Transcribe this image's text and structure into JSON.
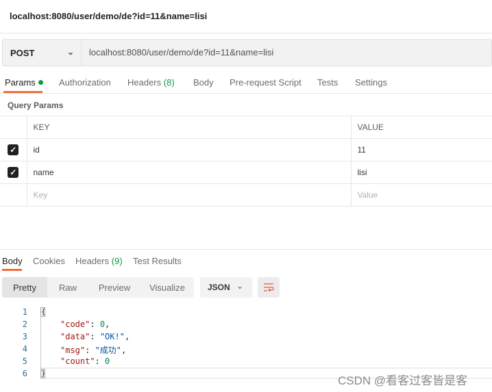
{
  "request_title": "localhost:8080/user/demo/de?id=11&name=lisi",
  "request": {
    "method": "POST",
    "url": "localhost:8080/user/demo/de?id=11&name=lisi"
  },
  "tabs": [
    {
      "label": "Params"
    },
    {
      "label": "Authorization"
    },
    {
      "label": "Headers",
      "count": "(8)"
    },
    {
      "label": "Body"
    },
    {
      "label": "Pre-request Script"
    },
    {
      "label": "Tests"
    },
    {
      "label": "Settings"
    }
  ],
  "query_params": {
    "title": "Query Params",
    "headers": {
      "key": "KEY",
      "value": "VALUE"
    },
    "rows": [
      {
        "key": "id",
        "value": "11",
        "checked": true
      },
      {
        "key": "name",
        "value": "lisi",
        "checked": true
      }
    ],
    "placeholder": {
      "key": "Key",
      "value": "Value"
    }
  },
  "response_tabs": [
    {
      "label": "Body"
    },
    {
      "label": "Cookies"
    },
    {
      "label": "Headers",
      "count": "(9)"
    },
    {
      "label": "Test Results"
    }
  ],
  "view_modes": [
    "Pretty",
    "Raw",
    "Preview",
    "Visualize"
  ],
  "format": "JSON",
  "code": {
    "line_numbers": [
      "1",
      "2",
      "3",
      "4",
      "5",
      "6"
    ],
    "open": "{",
    "close": "}",
    "fields": [
      {
        "key": "\"code\"",
        "value": "0",
        "sep": ",",
        "type": "n"
      },
      {
        "key": "\"data\"",
        "value": "\"OK!\"",
        "sep": ",",
        "type": "s"
      },
      {
        "key": "\"msg\"",
        "value": "\"成功\"",
        "sep": ",",
        "type": "s"
      },
      {
        "key": "\"count\"",
        "value": "0",
        "sep": "",
        "type": "n"
      }
    ]
  },
  "watermark": "CSDN @看客过客皆是客",
  "colors": {
    "accent": "#f26b3a",
    "green": "#0f9a3e"
  }
}
